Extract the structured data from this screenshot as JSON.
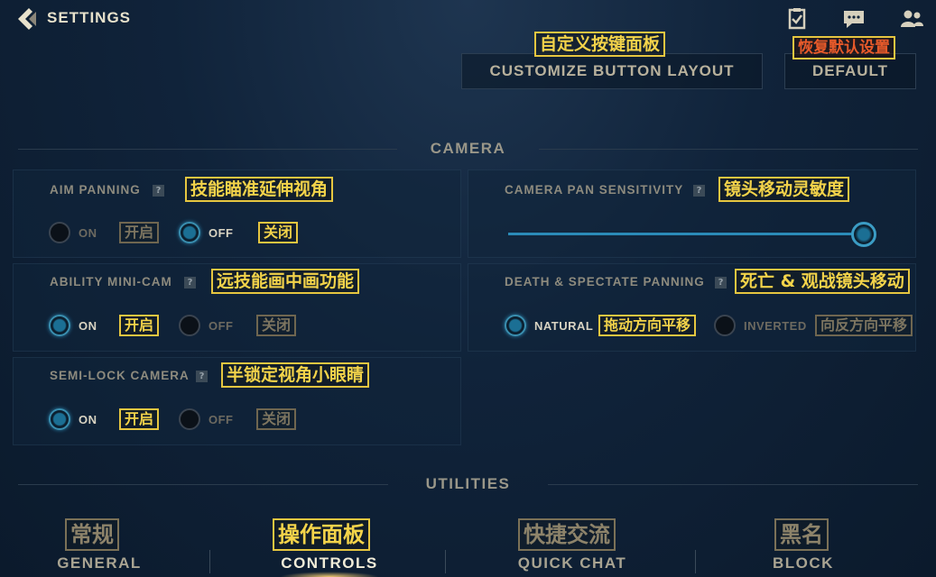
{
  "header": {
    "title": "SETTINGS",
    "icons": [
      "checklist-icon",
      "chat-icon",
      "friends-icon"
    ]
  },
  "top_buttons": {
    "customize_label": "CUSTOMIZE BUTTON LAYOUT",
    "customize_annotation": "自定义按键面板",
    "default_label": "DEFAULT",
    "default_annotation": "恢复默认设置"
  },
  "camera": {
    "title": "CAMERA",
    "aim_panning": {
      "label": "AIM PANNING",
      "annotation": "技能瞄准延伸视角",
      "on_label": "ON",
      "on_annotation": "开启",
      "off_label": "OFF",
      "off_annotation": "关闭",
      "selected": "off"
    },
    "camera_pan_sensitivity": {
      "label": "CAMERA PAN SENSITIVITY",
      "annotation": "镜头移动灵敏度",
      "value": 1.0
    },
    "ability_mini_cam": {
      "label": "ABILITY MINI-CAM",
      "annotation": "远技能画中画功能",
      "on_label": "ON",
      "on_annotation": "开启",
      "off_label": "OFF",
      "off_annotation": "关闭",
      "selected": "on"
    },
    "death_spectate_panning": {
      "label": "DEATH & SPECTATE PANNING",
      "annotation": "死亡 & 观战镜头移动",
      "natural_label": "NATURAL",
      "natural_annotation": "拖动方向平移",
      "inverted_label": "INVERTED",
      "inverted_annotation": "向反方向平移",
      "selected": "natural"
    },
    "semi_lock_camera": {
      "label": "SEMI-LOCK CAMERA",
      "annotation": "半锁定视角小眼睛",
      "on_label": "ON",
      "on_annotation": "开启",
      "off_label": "OFF",
      "off_annotation": "关闭",
      "selected": "on"
    }
  },
  "utilities": {
    "title": "UTILITIES"
  },
  "tabs": [
    {
      "label": "GENERAL",
      "annotation": "常规"
    },
    {
      "label": "CONTROLS",
      "annotation": "操作面板",
      "active": true
    },
    {
      "label": "QUICK CHAT",
      "annotation": "快捷交流"
    },
    {
      "label": "BLOCK",
      "annotation": "黑名"
    }
  ],
  "colors": {
    "accent_blue": "#2b8bb8",
    "annotation_yellow": "#f3d34a",
    "annotation_red": "#e85a2a",
    "background": "#10233a"
  }
}
